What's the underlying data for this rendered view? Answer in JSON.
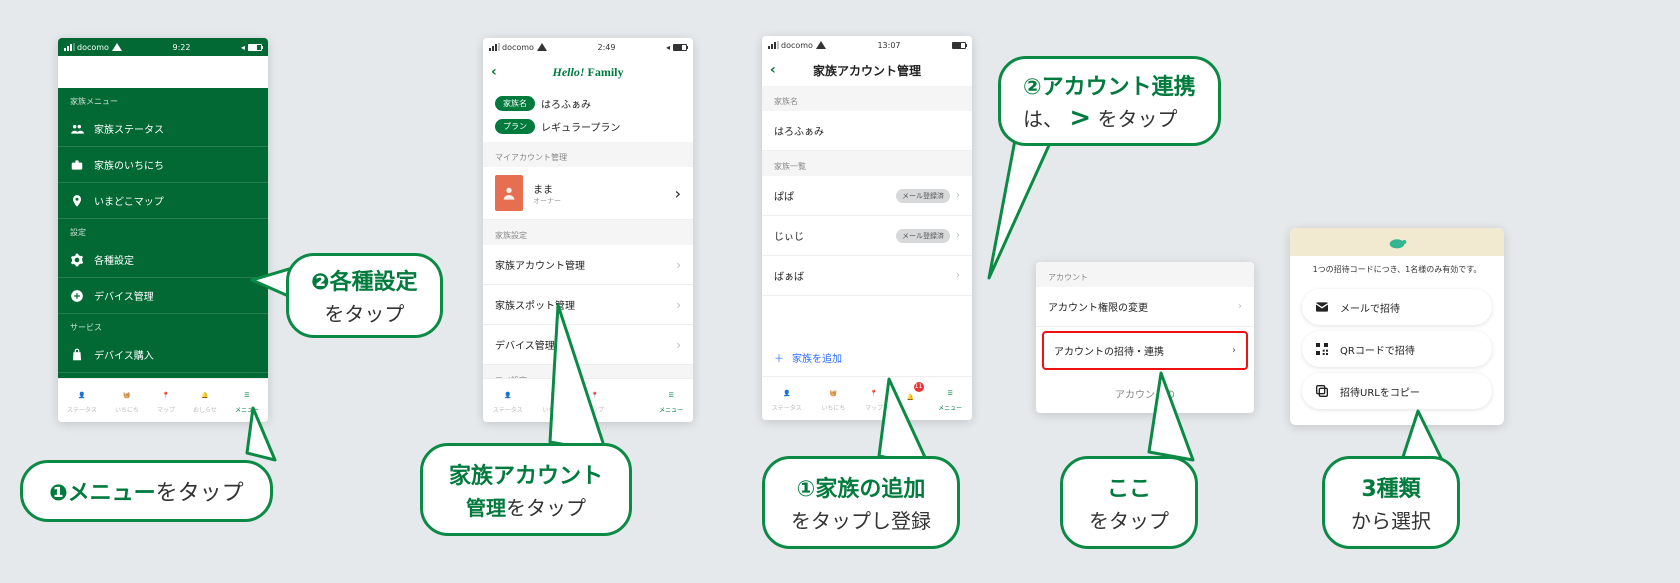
{
  "brand_prefix": "Hello!",
  "brand_bold": "Family",
  "screen1": {
    "status": {
      "carrier": "docomo",
      "time": "9:22"
    },
    "sections": {
      "family_label": "家族メニュー",
      "items_family": [
        {
          "icon": "users-icon",
          "label": "家族ステータス"
        },
        {
          "icon": "briefcase-icon",
          "label": "家族のいちにち"
        },
        {
          "icon": "pin-icon",
          "label": "いまどこマップ"
        }
      ],
      "settings_label": "設定",
      "items_settings": [
        {
          "icon": "gear-icon",
          "label": "各種設定"
        },
        {
          "icon": "plus-circle-icon",
          "label": "デバイス管理"
        }
      ],
      "service_label": "サービス",
      "items_service": [
        {
          "icon": "bag-icon",
          "label": "デバイス購入"
        }
      ]
    },
    "tabs": [
      "ステータス",
      "いちにち",
      "マップ",
      "おしらせ",
      "メニュー"
    ]
  },
  "screen2": {
    "status": {
      "carrier": "docomo",
      "time": "2:49"
    },
    "kv": {
      "family_name_label": "家族名",
      "family_name_value": "はろふぁみ",
      "plan_label": "プラン",
      "plan_value": "レギュラープラン"
    },
    "myacct_label": "マイアカウント管理",
    "owner": {
      "name": "まま",
      "role": "オーナー"
    },
    "family_settings_label": "家族設定",
    "rows": [
      "家族アカウント管理",
      "家族スポット管理",
      "デバイス管理"
    ],
    "mysettings_label": "マイ設定",
    "tabs": [
      "ステータス",
      "いちにち",
      "マップ",
      "",
      "メニュー"
    ]
  },
  "screen3": {
    "status": {
      "carrier": "docomo",
      "time": "13:07"
    },
    "header_title": "家族アカウント管理",
    "family_name_label": "家族名",
    "family_name_value": "はろふぁみ",
    "list_label": "家族一覧",
    "members": [
      {
        "name": "ぱぱ",
        "status": "メール登録済"
      },
      {
        "name": "じぃじ",
        "status": "メール登録済"
      },
      {
        "name": "ばぁば",
        "status": ""
      }
    ],
    "add_label": "家族を追加",
    "tabs": [
      "ステータス",
      "いちにち",
      "マップ",
      "",
      "メニュー"
    ],
    "badge_count": "11"
  },
  "fragment_account": {
    "section_label": "アカウント",
    "rows": [
      "アカウント権限の変更",
      "アカウントの招待・連携"
    ],
    "truncated_row": "アカウントの"
  },
  "invite": {
    "caption": "1つの招待コードにつき、1名様のみ有効です。",
    "options": [
      {
        "icon": "mail-icon",
        "label": "メールで招待"
      },
      {
        "icon": "qr-icon",
        "label": "QRコードで招待"
      },
      {
        "icon": "copy-icon",
        "label": "招待URLをコピー"
      }
    ]
  },
  "callouts": {
    "c1": {
      "num": "❶",
      "bold": "メニュー",
      "tail": "をタップ"
    },
    "c2": {
      "num": "❷",
      "bold": "各種設定",
      "sub": "をタップ"
    },
    "c3": {
      "line1": "家族アカウント",
      "line2a": "管理",
      "line2b": "をタップ"
    },
    "c4": {
      "num": "①",
      "bold": "家族の追加",
      "sub": "をタップし登録"
    },
    "c5": {
      "num": "②",
      "bold_inline": "アカウント連携",
      "line2a": "は、",
      "chev": ">",
      "line2c": " をタップ"
    },
    "c6": {
      "bold": "ここ",
      "sub": "をタップ"
    },
    "c7": {
      "bold": "3種類",
      "sub": "から選択"
    }
  }
}
